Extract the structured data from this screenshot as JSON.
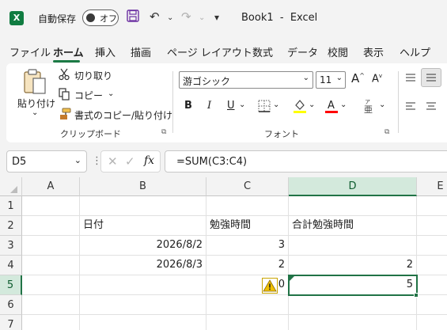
{
  "titlebar": {
    "app_logo": "X",
    "autosave_label": "自動保存",
    "autosave_state": "オフ",
    "undo_icon": "↶",
    "redo_icon": "↷",
    "customize_icon": "▾",
    "document_title": "Book1  -  Excel"
  },
  "tabs": [
    "ファイル",
    "ホーム",
    "挿入",
    "描画",
    "ページ レイアウト",
    "数式",
    "データ",
    "校閲",
    "表示",
    "ヘルプ"
  ],
  "active_tab_index": 1,
  "ribbon": {
    "clipboard": {
      "paste_label": "貼り付け",
      "cut_label": "切り取り",
      "copy_label": "コピー",
      "format_painter_label": "書式のコピー/貼り付け",
      "group_label": "クリップボード"
    },
    "font": {
      "font_name": "游ゴシック",
      "font_size": "11",
      "bold": "B",
      "italic": "I",
      "underline": "U",
      "group_label": "フォント",
      "fill_color": "#ffff00",
      "font_color": "#ff0000"
    }
  },
  "formula_bar": {
    "name_box": "D5",
    "formula": "=SUM(C3:C4)",
    "fx_label": "fx"
  },
  "sheet": {
    "columns": [
      "A",
      "B",
      "C",
      "D",
      "E"
    ],
    "selected_column": "D",
    "rows": [
      "1",
      "2",
      "3",
      "4",
      "5",
      "6",
      "7"
    ],
    "selected_row": "5",
    "cells": {
      "B2": "日付",
      "C2": "勉強時間",
      "D2": "合計勉強時間",
      "B3": "2026/8/2",
      "C3": "3",
      "B4": "2026/8/3",
      "C4": "2",
      "D4": "2",
      "C5": "0",
      "D5": "5"
    }
  },
  "colors": {
    "accent": "#217346",
    "warning": "#e6b000"
  }
}
